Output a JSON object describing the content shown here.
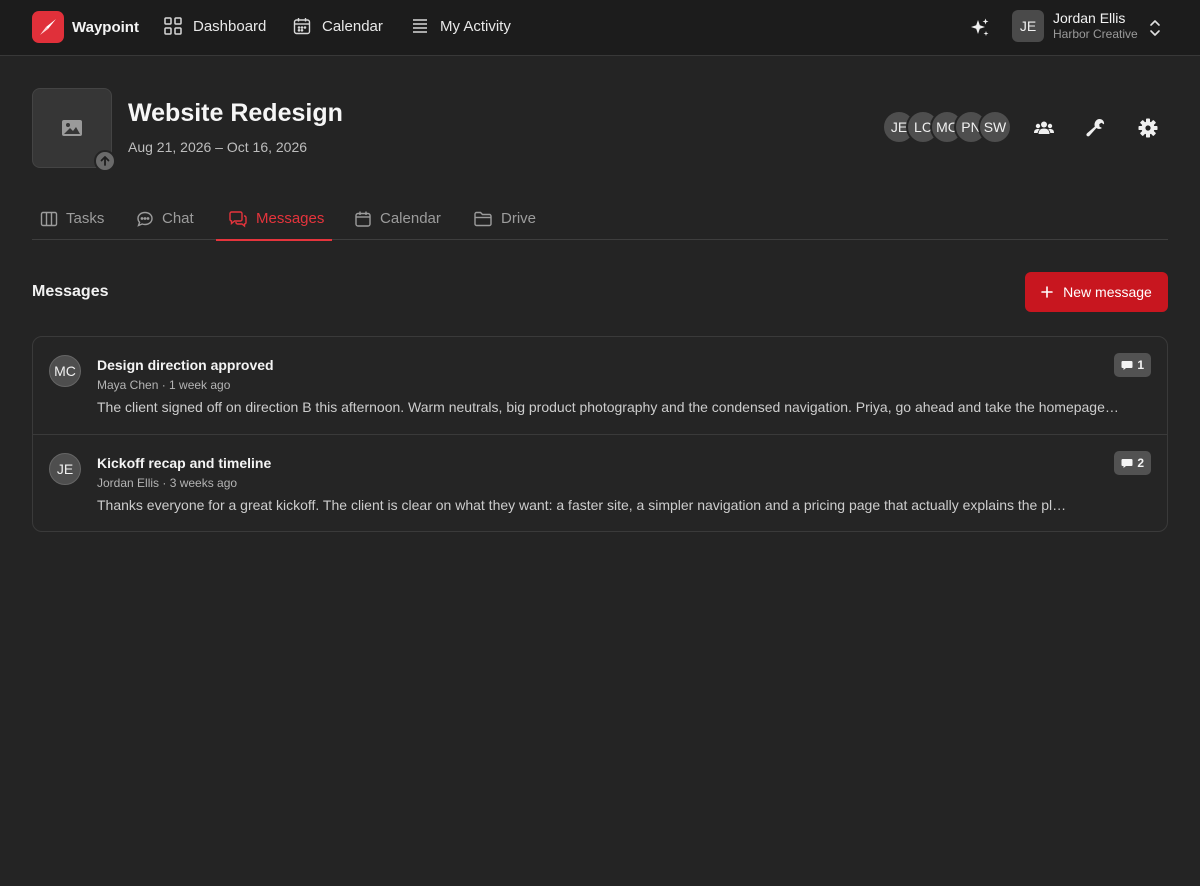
{
  "app": {
    "name": "Waypoint",
    "accent": "#e0303a"
  },
  "nav": {
    "dashboard": "Dashboard",
    "calendar": "Calendar",
    "activity": "My Activity"
  },
  "user": {
    "initials": "JE",
    "name": "Jordan Ellis",
    "org": "Harbor Creative"
  },
  "project": {
    "title": "Website Redesign",
    "dates": "Aug 21, 2026 – Oct 16, 2026",
    "members": [
      "JE",
      "LC",
      "MC",
      "PN",
      "SW"
    ]
  },
  "tabs": [
    {
      "label": "Tasks",
      "icon": "columns-icon"
    },
    {
      "label": "Chat",
      "icon": "chat-bubble-icon"
    },
    {
      "label": "Messages",
      "icon": "messages-icon",
      "active": true
    },
    {
      "label": "Calendar",
      "icon": "calendar-icon"
    },
    {
      "label": "Drive",
      "icon": "folder-icon"
    }
  ],
  "messages_section": {
    "title": "Messages",
    "new_button": "New message",
    "items": [
      {
        "initials": "MC",
        "title": "Design direction approved",
        "author": "Maya Chen",
        "time": "1 week ago",
        "meta": "Maya Chen · 1 week ago",
        "preview": "The client signed off on direction B this afternoon. Warm neutrals, big product photography and the condensed navigation. Priya, go ahead and take the homepage…",
        "comments": "1"
      },
      {
        "initials": "JE",
        "title": "Kickoff recap and timeline",
        "author": "Jordan Ellis",
        "time": "3 weeks ago",
        "meta": "Jordan Ellis · 3 weeks ago",
        "preview": "Thanks everyone for a great kickoff. The client is clear on what they want: a faster site, a simpler navigation and a pricing page that actually explains the pl…",
        "comments": "2"
      }
    ]
  }
}
